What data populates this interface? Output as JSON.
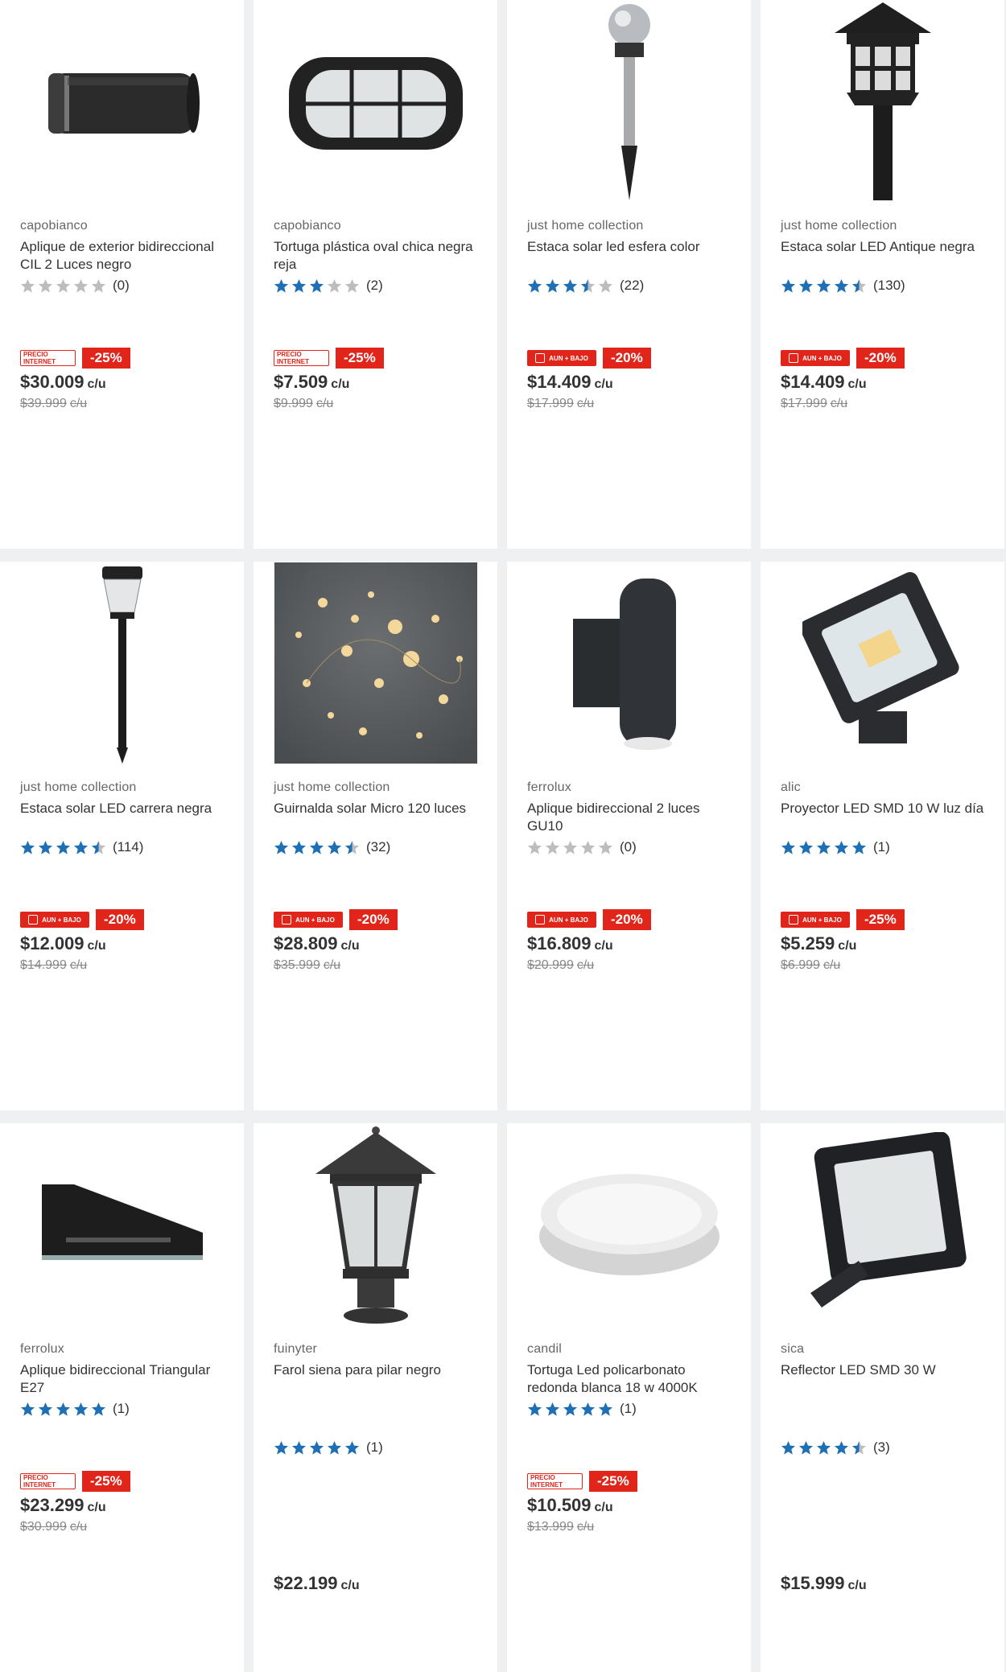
{
  "products": [
    {
      "brand": "capobianco",
      "title": "Aplique de exterior bidireccional CIL 2 Luces negro",
      "rating": 0,
      "reviews": "(0)",
      "tag": "PRECIO INTERNET",
      "discount": "-25%",
      "price": "$30.009",
      "old_price": "$39.999",
      "unit": "c/u",
      "image": "cylinder-wall-light"
    },
    {
      "brand": "capobianco",
      "title": "Tortuga plástica oval chica negra reja",
      "rating": 3,
      "reviews": "(2)",
      "tag": "PRECIO INTERNET",
      "discount": "-25%",
      "price": "$7.509",
      "old_price": "$9.999",
      "unit": "c/u",
      "image": "oval-bulkhead-light"
    },
    {
      "brand": "just home collection",
      "title": "Estaca solar led esfera color",
      "rating": 3.5,
      "reviews": "(22)",
      "tag": "AUN + BAJO",
      "discount": "-20%",
      "price": "$14.409",
      "old_price": "$17.999",
      "unit": "c/u",
      "image": "solar-globe-stake"
    },
    {
      "brand": "just home collection",
      "title": "Estaca solar LED Antique negra",
      "rating": 4.5,
      "reviews": "(130)",
      "tag": "AUN + BAJO",
      "discount": "-20%",
      "price": "$14.409",
      "old_price": "$17.999",
      "unit": "c/u",
      "image": "antique-solar-stake"
    },
    {
      "brand": "just home collection",
      "title": "Estaca solar LED carrera negra",
      "rating": 4.5,
      "reviews": "(114)",
      "tag": "AUN + BAJO",
      "discount": "-20%",
      "price": "$12.009",
      "old_price": "$14.999",
      "unit": "c/u",
      "image": "solar-path-stake"
    },
    {
      "brand": "just home collection",
      "title": "Guirnalda solar Micro 120 luces",
      "rating": 4.5,
      "reviews": "(32)",
      "tag": "AUN + BAJO",
      "discount": "-20%",
      "price": "$28.809",
      "old_price": "$35.999",
      "unit": "c/u",
      "image": "micro-fairy-lights"
    },
    {
      "brand": "ferrolux",
      "title": "Aplique bidireccional 2 luces GU10",
      "rating": 0,
      "reviews": "(0)",
      "tag": "AUN + BAJO",
      "discount": "-20%",
      "price": "$16.809",
      "old_price": "$20.999",
      "unit": "c/u",
      "image": "tube-wall-light"
    },
    {
      "brand": "alic",
      "title": "Proyector LED SMD 10 W luz día",
      "rating": 5,
      "reviews": "(1)",
      "tag": "AUN + BAJO",
      "discount": "-25%",
      "price": "$5.259",
      "old_price": "$6.999",
      "unit": "c/u",
      "image": "led-floodlight-small"
    },
    {
      "brand": "ferrolux",
      "title": "Aplique bidireccional Triangular E27",
      "rating": 5,
      "reviews": "(1)",
      "tag": "PRECIO INTERNET",
      "discount": "-25%",
      "price": "$23.299",
      "old_price": "$30.999",
      "unit": "c/u",
      "image": "triangular-wall-light"
    },
    {
      "brand": "fuinyter",
      "title": "Farol siena para pilar negro",
      "rating": 5,
      "reviews": "(1)",
      "tag": "",
      "discount": "",
      "price": "$22.199",
      "old_price": "",
      "unit": "c/u",
      "image": "pillar-lantern"
    },
    {
      "brand": "candil",
      "title": "Tortuga Led policarbonato redonda blanca 18 w 4000K",
      "rating": 5,
      "reviews": "(1)",
      "tag": "PRECIO INTERNET",
      "discount": "-25%",
      "price": "$10.509",
      "old_price": "$13.999",
      "unit": "c/u",
      "image": "round-ceiling-light"
    },
    {
      "brand": "sica",
      "title": "Reflector LED SMD 30 W",
      "rating": 4.5,
      "reviews": "(3)",
      "tag": "",
      "discount": "",
      "price": "$15.999",
      "old_price": "",
      "unit": "c/u",
      "image": "led-floodlight-large"
    }
  ],
  "colors": {
    "star": "#1f6fb5",
    "star_empty": "#bdbdbd",
    "sale": "#e1251b"
  }
}
